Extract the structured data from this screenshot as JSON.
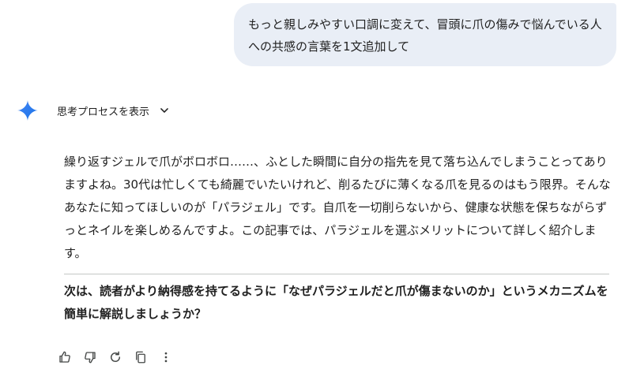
{
  "user_message": {
    "text": "もっと親しみやすい口調に変えて、冒頭に爪の傷みで悩んでいる人への共感の言葉を1文追加して"
  },
  "response": {
    "thinking_label": "思考プロセスを表示",
    "icons": [
      "gemini-spark-icon",
      "chevron-down-icon"
    ],
    "body": "繰り返すジェルで爪がボロボロ……、ふとした瞬間に自分の指先を見て落ち込んでしまうことってありますよね。30代は忙しくても綺麗でいたいけれど、削るたびに薄くなる爪を見るのはもう限界。そんなあなたに知ってほしいのが「パラジェル」です。自爪を一切削らないから、健康な状態を保ちながらずっとネイルを楽しめるんですよ。この記事では、パラジェルを選ぶメリットについて詳しく紹介します。",
    "followup": "次は、読者がより納得感を持てるように「なぜパラジェルだと爪が傷まないのか」というメカニズムを簡単に解説しましょうか？"
  },
  "action_bar": {
    "icons": [
      "thumbs-up-icon",
      "thumbs-down-icon",
      "regenerate-icon",
      "copy-icon",
      "more-vert-icon"
    ]
  },
  "colors": {
    "bubble_bg": "#e9eef6",
    "text": "#1f1f1f",
    "icon": "#444746",
    "spark_blue": "#4285f4",
    "divider": "#c4c7c5"
  }
}
